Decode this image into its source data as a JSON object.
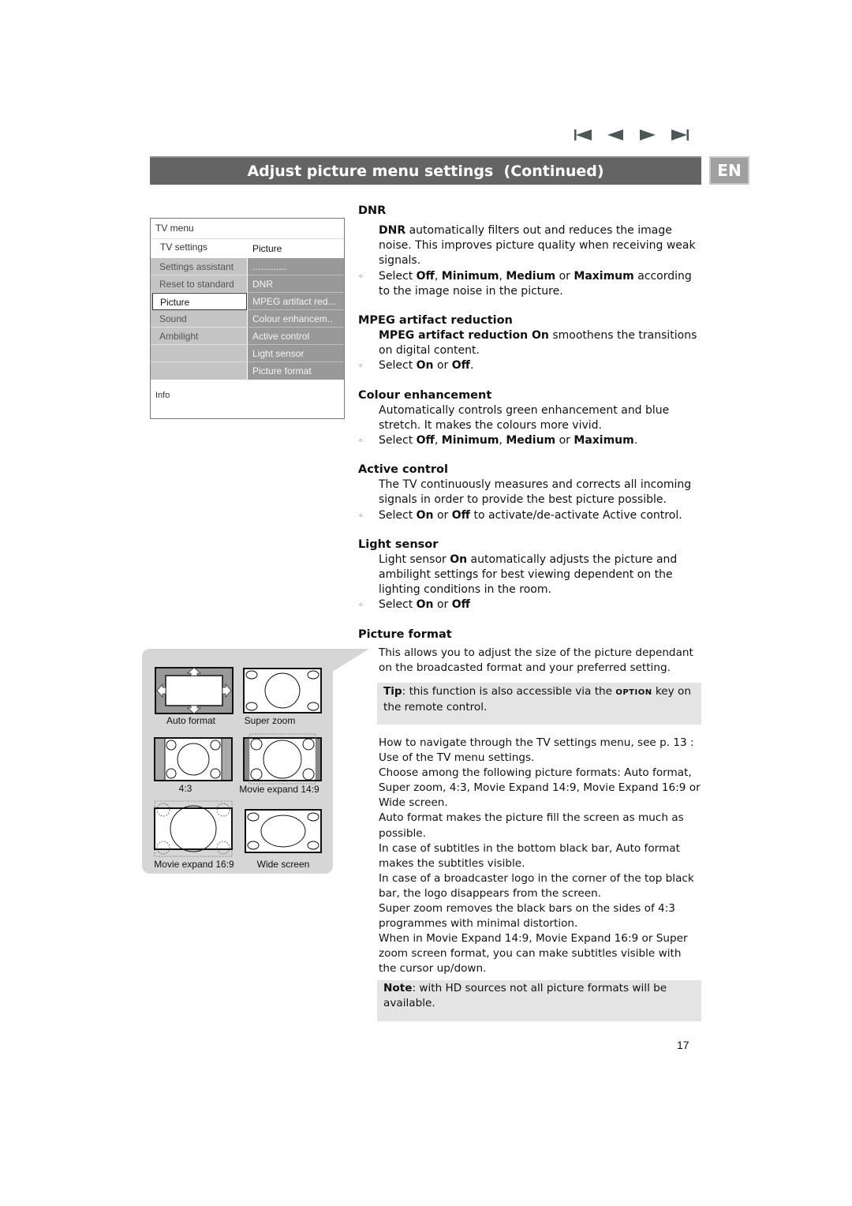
{
  "navigation": {
    "buttons": [
      {
        "name": "first-page",
        "icon": "skip-to-start-icon"
      },
      {
        "name": "previous-page",
        "icon": "triangle-left-icon"
      },
      {
        "name": "next-page",
        "icon": "triangle-right-icon"
      },
      {
        "name": "last-page",
        "icon": "skip-to-end-icon"
      }
    ]
  },
  "header": {
    "title": "Adjust picture menu settings  (Continued)",
    "language_badge": "EN"
  },
  "tv_menu": {
    "title": "TV menu",
    "breadcrumb_left": "TV settings",
    "breadcrumb_right": "Picture",
    "left_items": [
      {
        "label": "Settings assistant",
        "selected": false
      },
      {
        "label": "Reset to standard",
        "selected": false
      },
      {
        "label": "Picture",
        "selected": true
      },
      {
        "label": "Sound",
        "selected": false
      },
      {
        "label": "Ambilight",
        "selected": false
      },
      {
        "label": "",
        "selected": false
      },
      {
        "label": "",
        "selected": false
      }
    ],
    "right_items": [
      {
        "label": "............."
      },
      {
        "label": "DNR"
      },
      {
        "label": "MPEG artifact red..."
      },
      {
        "label": "Colour enhancem.."
      },
      {
        "label": "Active control"
      },
      {
        "label": "Light sensor"
      },
      {
        "label": "Picture format"
      }
    ],
    "info_label": "Info"
  },
  "picture_formats": [
    {
      "label": "Auto format"
    },
    {
      "label": "Super zoom"
    },
    {
      "label": "4:3"
    },
    {
      "label": "Movie expand 14:9"
    },
    {
      "label": "Movie expand 16:9"
    },
    {
      "label": "Wide screen"
    }
  ],
  "sections": {
    "dnr": {
      "heading": "DNR",
      "desc_bold": "DNR",
      "desc": " automatically filters out and reduces the image noise. This improves picture quality when receiving weak signals.",
      "bullet": {
        "pre": "Select ",
        "o1": "Off",
        "s1": ", ",
        "o2": "Minimum",
        "s2": ", ",
        "o3": "Medium",
        "s3": " or ",
        "o4": "Maximum",
        "post": " according to the image noise in the picture."
      }
    },
    "mpeg": {
      "heading": "MPEG artifact reduction",
      "desc_bold": "MPEG artifact reduction On",
      "desc": " smoothens the transitions on digital content.",
      "bullet": {
        "pre": "Select ",
        "o1": "On",
        "s1": " or ",
        "o2": "Off",
        "post": "."
      }
    },
    "colour": {
      "heading": "Colour enhancement",
      "desc": "Automatically controls green enhancement and blue stretch. It makes the colours more vivid.",
      "bullet": {
        "pre": "Select ",
        "o1": "Off",
        "s1": ", ",
        "o2": "Minimum",
        "s2": ", ",
        "o3": "Medium",
        "s3": " or ",
        "o4": "Maximum",
        "post": "."
      }
    },
    "active": {
      "heading": "Active control",
      "desc": "The TV continuously measures and corrects all incoming signals in order to provide the best picture possible.",
      "bullet": {
        "pre": "Select ",
        "o1": "On",
        "s1": " or ",
        "o2": "Off",
        "post": " to activate/de-activate Active control."
      }
    },
    "light": {
      "heading": "Light sensor",
      "desc_pre": "Light sensor ",
      "desc_bold": "On",
      "desc": " automatically adjusts the picture and ambilight settings for best viewing dependent on the lighting conditions in the room.",
      "bullet": {
        "pre": "Select ",
        "o1": "On",
        "s1": " or ",
        "o2": "Off",
        "post": ""
      }
    },
    "picture_format": {
      "heading": "Picture format",
      "desc": "This allows you to adjust the size of the picture dependant on the broadcasted format and your preferred setting.",
      "tip_label": "Tip",
      "tip_pre": ": this function is also accessible via the ",
      "tip_key": "OPTION",
      "tip_post": " key on the remote control.",
      "paragraphs": [
        "How to navigate through the TV settings menu, see p. 13 : Use of the TV menu settings.",
        "Choose among the following picture formats: Auto format, Super zoom, 4:3, Movie Expand 14:9, Movie Expand 16:9 or Wide screen.",
        "Auto format makes the picture fill the screen as much as possible.",
        "In case of subtitles in the bottom black bar, Auto format makes the subtitles visible.",
        "In case of a broadcaster logo in the corner of the top black bar, the logo disappears from the screen.",
        "Super zoom removes the black bars on the sides of 4:3 programmes with minimal distortion.",
        "When in Movie Expand 14:9, Movie Expand 16:9 or Super zoom screen format, you can make subtitles visible with the cursor up/down."
      ],
      "note_label": "Note",
      "note_text": ": with HD sources not all picture formats will be available."
    }
  },
  "bullet_glyph": "◦",
  "page_number": "17"
}
